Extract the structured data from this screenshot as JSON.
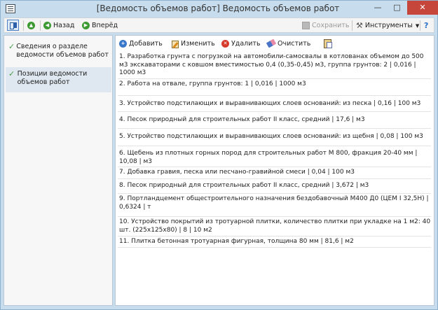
{
  "window": {
    "title": "[Ведомость объемов работ] Ведомость объемов работ"
  },
  "toolbar": {
    "back_label": "Назад",
    "forward_label": "Вперёд",
    "save_label": "Сохранить",
    "tools_label": "Инструменты",
    "help_label": "?"
  },
  "sidebar": {
    "items": [
      {
        "label": "Сведения о разделе ведомости объемов работ"
      },
      {
        "label": "Позиции ведомости объемов работ"
      }
    ]
  },
  "actions": {
    "add_label": "Добавить",
    "edit_label": "Изменить",
    "delete_label": "Удалить",
    "clear_label": "Очистить"
  },
  "positions": [
    "1. Разработка грунта с погрузкой на автомобили-самосвалы в котлованах объемом до 500 м3 экскаваторами с ковшом вместимостью 0,4 (0,35-0,45) м3, группа грунтов: 2 | 0,016 | 1000 м3",
    "2. Работа на отвале, группа грунтов: 1 | 0,016 | 1000 м3",
    "3. Устройство подстилающих и выравнивающих слоев оснований: из песка | 0,16 | 100 м3",
    "4. Песок природный для строительных работ II класс, средний | 17,6 | м3",
    "5. Устройство подстилающих и выравнивающих слоев оснований: из щебня | 0,08 | 100 м3",
    "6. Щебень из плотных горных пород для строительных работ М 800, фракция 20-40 мм | 10,08 | м3",
    "7. Добавка гравия, песка или песчано-гравийной смеси | 0,04 | 100 м3",
    "8. Песок природный для строительных работ II класс, средний | 3,672 | м3",
    "9. Портландцемент общестроительного назначения бездобавочный М400 Д0 (ЦЕМ I 32,5Н) | 0,6324 | т",
    "10. Устройство покрытий из тротуарной плитки, количество плитки при укладке на 1 м2: 40 шт. (225х125х80) | 8 | 10 м2",
    "11. Плитка бетонная тротуарная фигурная, толщина 80 мм | 81,6 | м2"
  ]
}
